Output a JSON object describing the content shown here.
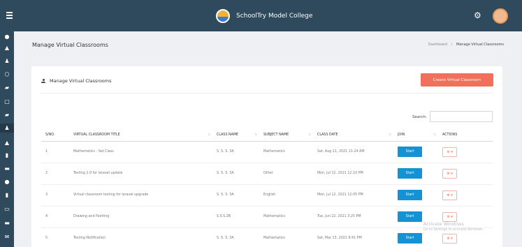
{
  "topbar": {
    "brand_name": "SchoolTry Model College",
    "icons": [
      "menu-icon",
      "gear-icon",
      "user-avatar"
    ]
  },
  "sidebar": {
    "icons": [
      "dashboard-icon",
      "user-icon",
      "users-icon",
      "lock-icon",
      "book-icon",
      "file-icon",
      "folder-icon",
      "users-icon",
      "user-icon",
      "document-icon",
      "card-icon",
      "circle-icon",
      "report-icon",
      "laptop-icon",
      "minus-icon",
      "mail-icon"
    ]
  },
  "page": {
    "title": "Manage Virtual Classrooms",
    "breadcrumb": {
      "parent": "Dashboard",
      "separator": "/",
      "current": "Manage Virtual Classrooms"
    }
  },
  "card": {
    "title": "Manage Virtual Classrooms",
    "create_button": "Create Virtual Classroom",
    "search_label": "Search:",
    "search_value": ""
  },
  "table": {
    "columns": [
      "S/NO.",
      "VIRTUAL CLASSROOM TITLE",
      "CLASS NAME",
      "SUBJECT NAME",
      "CLASS DATE",
      "JOIN",
      "ACTIONS"
    ],
    "rows": [
      {
        "sno": "1",
        "title": "Mathematics - Set Class",
        "class_name": "S. S. S. 3A",
        "subject": "Mathematics",
        "date": "Sat, Aug 21, 2021 11:24 AM",
        "join": "Start",
        "actions": "⚙ ▾"
      },
      {
        "sno": "2",
        "title": "Testing 2.0 for laravel update",
        "class_name": "S. S. S. 3A",
        "subject": "Other",
        "date": "Mon, Jul 12, 2021 12:10 PM",
        "join": "Start",
        "actions": "⚙ ▾"
      },
      {
        "sno": "3",
        "title": "Virtual classroom testing for laravel upgrade",
        "class_name": "S. S. S. 3A",
        "subject": "English",
        "date": "Mon, Jul 12, 2021 12:05 PM",
        "join": "Start",
        "actions": "⚙ ▾"
      },
      {
        "sno": "4",
        "title": "Drawing and Painting",
        "class_name": "S.S.S.2B",
        "subject": "Mathematics",
        "date": "Tue, Jun 22, 2021 3:25 PM",
        "join": "Start",
        "actions": "⚙ ▾"
      },
      {
        "sno": "5",
        "title": "Testing Notification",
        "class_name": "S. S. S. 3A",
        "subject": "Mathematics",
        "date": "Sat, Mar 13, 2021 9:41 PM",
        "join": "Start",
        "actions": "⚙ ▾"
      }
    ]
  },
  "watermark": {
    "line1": "Activate Windows",
    "line2": "Go to Settings to activate Windows."
  },
  "colors": {
    "topbar": "#2f4a5c",
    "sidebar": "#2f4a5c",
    "create_button": "#f1705c",
    "start_button": "#1592d4",
    "background": "#eef0f3"
  }
}
